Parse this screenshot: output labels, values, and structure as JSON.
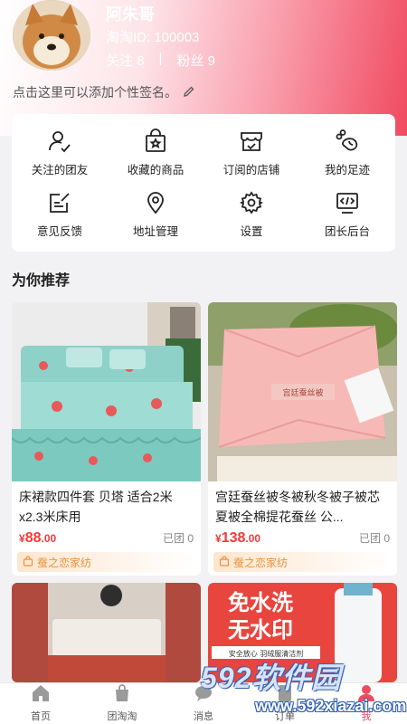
{
  "profile": {
    "username": "阿朱哥",
    "user_id": "淘淘ID: 100003",
    "following": "关注 8",
    "separator": "|",
    "followers": "粉丝 9",
    "signature": "点击这里可以添加个性签名。"
  },
  "menu": {
    "items": [
      {
        "label": "关注的团友",
        "icon": "user-check-icon"
      },
      {
        "label": "收藏的商品",
        "icon": "star-bag-icon"
      },
      {
        "label": "订阅的店铺",
        "icon": "store-icon"
      },
      {
        "label": "我的足迹",
        "icon": "footprint-icon"
      },
      {
        "label": "意见反馈",
        "icon": "feedback-icon"
      },
      {
        "label": "地址管理",
        "icon": "location-pin-icon"
      },
      {
        "label": "设置",
        "icon": "gear-icon"
      },
      {
        "label": "团长后台",
        "icon": "code-monitor-icon"
      }
    ]
  },
  "recommend": {
    "title": "为你推荐",
    "products": [
      {
        "title": "床裙款四件套 贝塔 适合2米x2.3米床用",
        "price_symbol": "¥",
        "price_int": "88",
        "price_dec": ".00",
        "sold": "已团 0",
        "shop": "蚕之恋家纺"
      },
      {
        "title": "宫廷蚕丝被冬被秋冬被子被芯夏被全棉提花蚕丝 公...",
        "price_symbol": "¥",
        "price_int": "138",
        "price_dec": ".00",
        "sold": "已团 0",
        "shop": "蚕之恋家纺"
      },
      {
        "title": "",
        "banner_line1": "免水洗",
        "banner_line2": "无水印"
      },
      {
        "title": ""
      }
    ]
  },
  "product_images": {
    "p2_label": "宫廷蚕丝被",
    "p3_banner_line1": "免水洗",
    "p3_banner_line2": "无水印",
    "p3_banner_small": "安全放心 羽绒服清洁剂"
  },
  "tabbar": {
    "items": [
      {
        "label": "首页",
        "icon": "home-icon"
      },
      {
        "label": "团淘淘",
        "icon": "shopping-bag-icon"
      },
      {
        "label": "消息",
        "icon": "chat-icon"
      },
      {
        "label": "订单",
        "icon": "order-icon"
      },
      {
        "label": "我",
        "icon": "user-icon"
      }
    ]
  },
  "watermark": {
    "brand": "592软件园",
    "url": "www.592xiazai.com"
  },
  "colors": {
    "accent": "#f04a60",
    "price": "#f23a3a",
    "shop_tag": "#e8923b"
  }
}
